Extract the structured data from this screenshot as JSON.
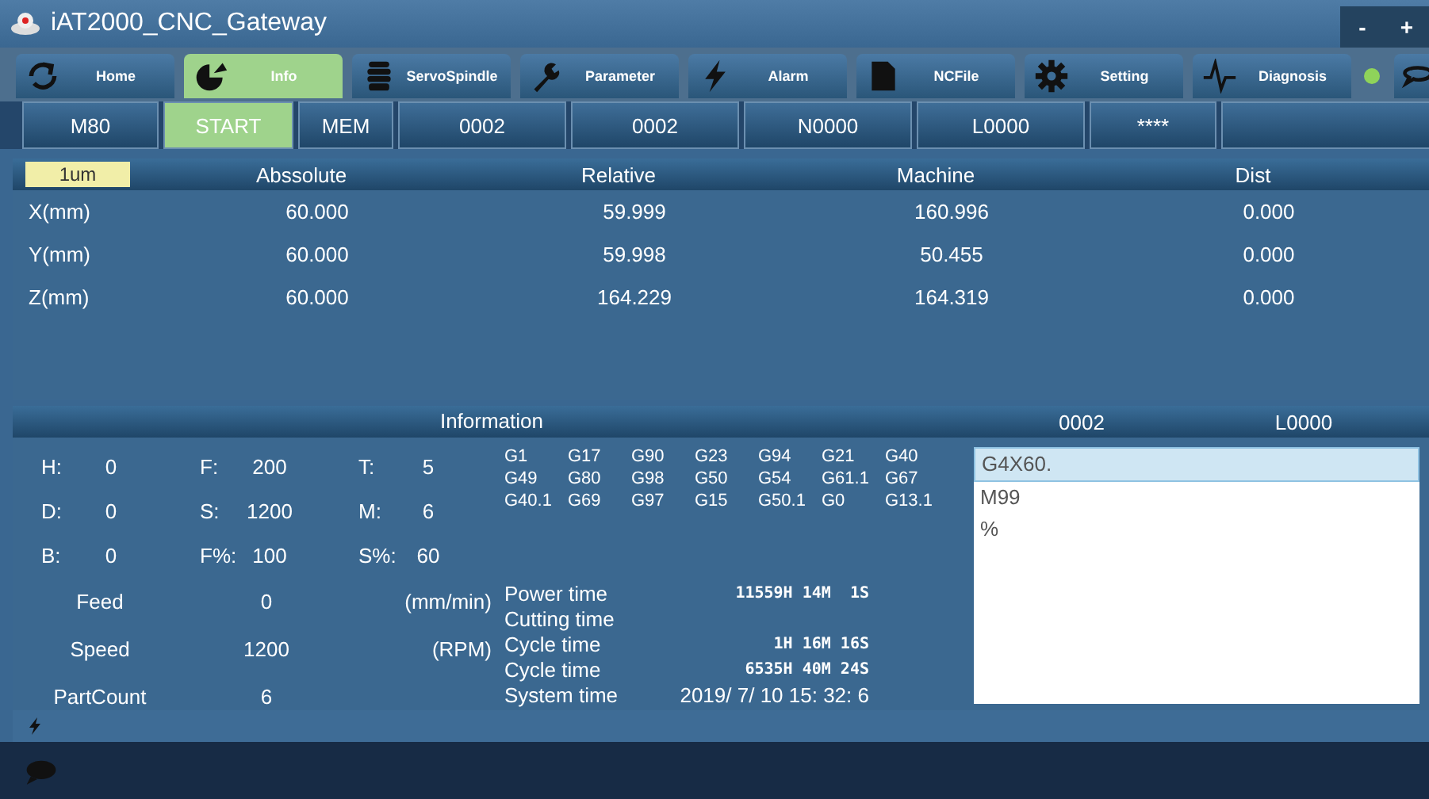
{
  "window": {
    "title": "iAT2000_CNC_Gateway",
    "controls": [
      "-",
      "+"
    ]
  },
  "nav_tabs": [
    {
      "label": "Home",
      "selected": false
    },
    {
      "label": "Info",
      "selected": true
    },
    {
      "label": "ServoSpindle",
      "selected": false
    },
    {
      "label": "Parameter",
      "selected": false
    },
    {
      "label": "Alarm",
      "selected": false
    },
    {
      "label": "NCFile",
      "selected": false
    },
    {
      "label": "Setting",
      "selected": false
    },
    {
      "label": "Diagnosis",
      "selected": false
    }
  ],
  "connection": {
    "color": "#8fd35a"
  },
  "status_cells": [
    {
      "text": "M80",
      "selected": false
    },
    {
      "text": "START",
      "selected": true
    },
    {
      "text": "MEM",
      "selected": false
    },
    {
      "text": "0002",
      "selected": false
    },
    {
      "text": "0002",
      "selected": false
    },
    {
      "text": "N0000",
      "selected": false
    },
    {
      "text": "L0000",
      "selected": false
    },
    {
      "text": "****",
      "selected": false
    }
  ],
  "position": {
    "unit": "1um",
    "columns": [
      "Abssolute",
      "Relative",
      "Machine",
      "Dist"
    ],
    "rows": [
      {
        "axis": "X(mm)",
        "values": [
          "60.000",
          "59.999",
          "160.996",
          "0.000"
        ]
      },
      {
        "axis": "Y(mm)",
        "values": [
          "60.000",
          "59.998",
          "50.455",
          "0.000"
        ]
      },
      {
        "axis": "Z(mm)",
        "values": [
          "60.000",
          "164.229",
          "164.319",
          "0.000"
        ]
      }
    ]
  },
  "information": {
    "title": "Information",
    "modal": [
      [
        {
          "label": "H:",
          "value": "0"
        },
        {
          "label": "F:",
          "value": "200"
        },
        {
          "label": "T:",
          "value": "5"
        }
      ],
      [
        {
          "label": "D:",
          "value": "0"
        },
        {
          "label": "S:",
          "value": "1200"
        },
        {
          "label": "M:",
          "value": "6"
        }
      ],
      [
        {
          "label": "B:",
          "value": "0"
        },
        {
          "label": "F%:",
          "value": "100"
        },
        {
          "label": "S%:",
          "value": "60"
        }
      ]
    ],
    "g_codes": [
      "G1",
      "G17",
      "G90",
      "G23",
      "G94",
      "G21",
      "G40",
      "G49",
      "G80",
      "G98",
      "G50",
      "G54",
      "G61.1",
      "G67",
      "G40.1",
      "G69",
      "G97",
      "G15",
      "G50.1",
      "G0",
      "G13.1"
    ],
    "rates": [
      {
        "label": "Feed",
        "value": "0",
        "unit": "(mm/min)"
      },
      {
        "label": "Speed",
        "value": "1200",
        "unit": "(RPM)"
      },
      {
        "label": "PartCount",
        "value": "6"
      }
    ],
    "times": [
      {
        "label": "Power time",
        "value": "11559H 14M  1S"
      },
      {
        "label": "Cutting time"
      },
      {
        "label": "Cycle time",
        "value": "1H 16M 16S"
      },
      {
        "label": "Cycle time",
        "value": "6535H 40M 24S"
      },
      {
        "label": "System time",
        "value": "2019/ 7/ 10 15: 32: 6"
      }
    ]
  },
  "program": {
    "headers": [
      "0002",
      "L0000"
    ],
    "lines": [
      {
        "text": "G4X60.",
        "selected": true
      },
      {
        "text": "M99",
        "selected": false
      },
      {
        "text": "%",
        "selected": false
      }
    ]
  }
}
